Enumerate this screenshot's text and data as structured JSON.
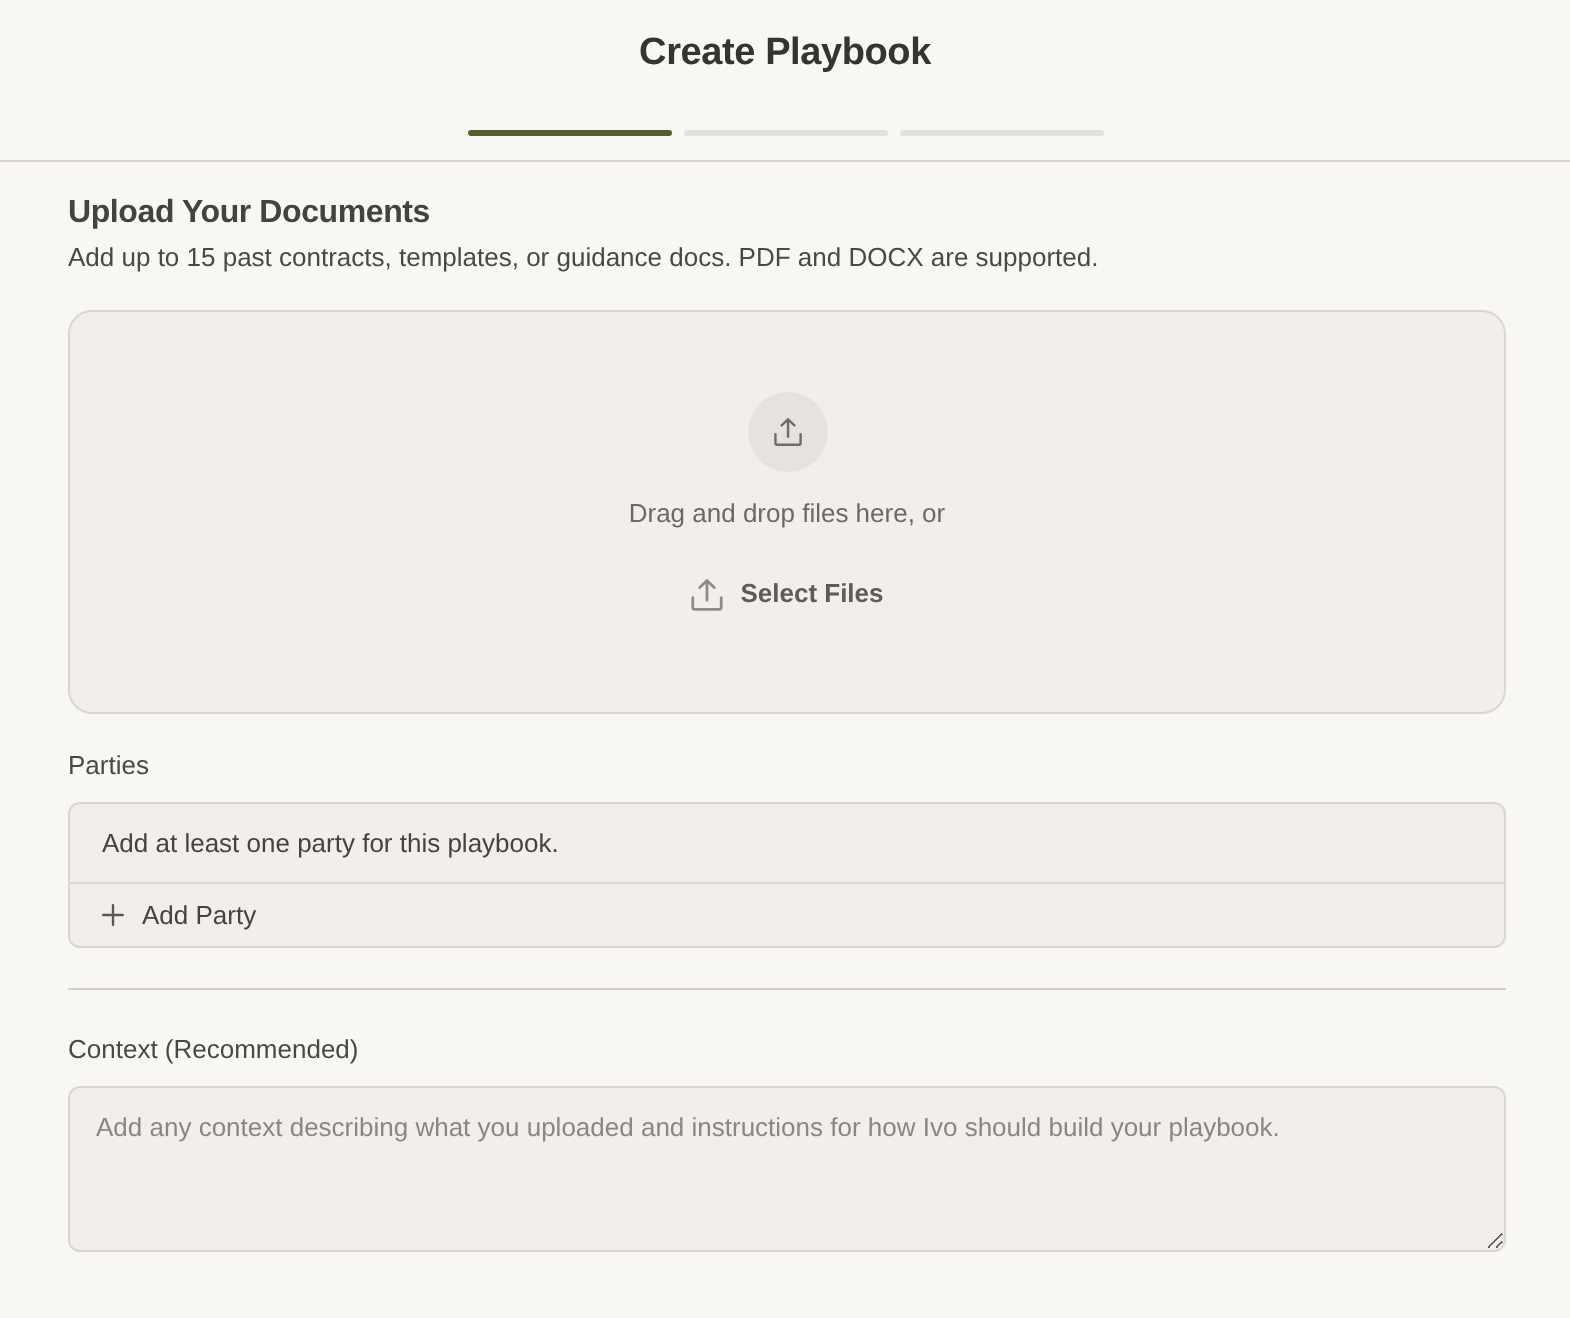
{
  "header": {
    "title": "Create Playbook"
  },
  "steps": [
    {
      "active": true
    },
    {
      "active": false
    },
    {
      "active": false
    }
  ],
  "upload": {
    "heading": "Upload Your Documents",
    "description": "Add up to 15 past contracts, templates, or guidance docs. PDF and DOCX are supported.",
    "dropzone_text": "Drag and drop files here, or",
    "button": "Select Files"
  },
  "parties": {
    "label": "Parties",
    "empty_message": "Add at least one party for this playbook.",
    "add_button": "Add Party"
  },
  "context": {
    "label": "Context (Recommended)",
    "placeholder": "Add any context describing what you uploaded and instructions for how Ivo should build your playbook."
  }
}
